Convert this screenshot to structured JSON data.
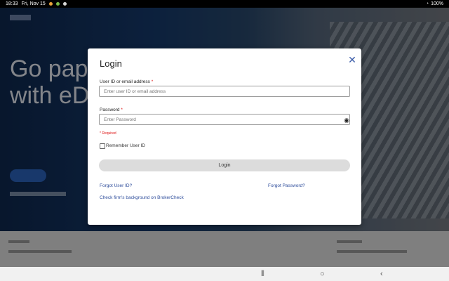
{
  "status": {
    "time": "18:33",
    "date": "Fri, Nov 15",
    "battery": "100%"
  },
  "modal": {
    "title": "Login",
    "user_label": "User ID or email address",
    "user_placeholder": "Enter user ID or email address",
    "password_label": "Password",
    "password_placeholder": "Enter Password",
    "required_mark": "*",
    "required_note": "* Required",
    "remember_label": "Remember User ID",
    "login_button": "Login",
    "forgot_user": "Forgot User ID?",
    "forgot_password": "Forgot Password?",
    "broker_link": "Check firm's background on BrokerCheck"
  },
  "background": {
    "hero_title": "Go paper\nwith eDe"
  },
  "icons": {
    "close": "close-icon",
    "eye": "eye-icon",
    "back": "back-icon",
    "home": "home-icon",
    "recents": "recents-icon"
  }
}
